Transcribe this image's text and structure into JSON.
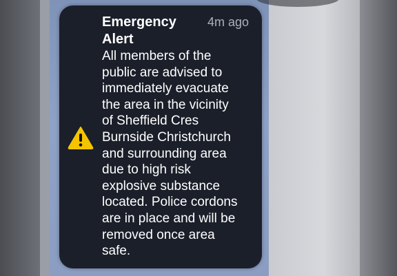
{
  "notification": {
    "title": "Emergency\nAlert",
    "time": "4m ago",
    "message": "All members of the\npublic are advised to\nimmediately evacuate\nthe area in the vicinity\nof Sheffield Cres\nBurnside Christchurch\nand surrounding area\ndue to high risk\nexplosive substance\nlocated. Police cordons\nare in place and will be\nremoved once area\nsafe.",
    "icon": "warning-triangle-icon",
    "accent_color": "#f5c400",
    "card_color": "#1b1f2a"
  }
}
